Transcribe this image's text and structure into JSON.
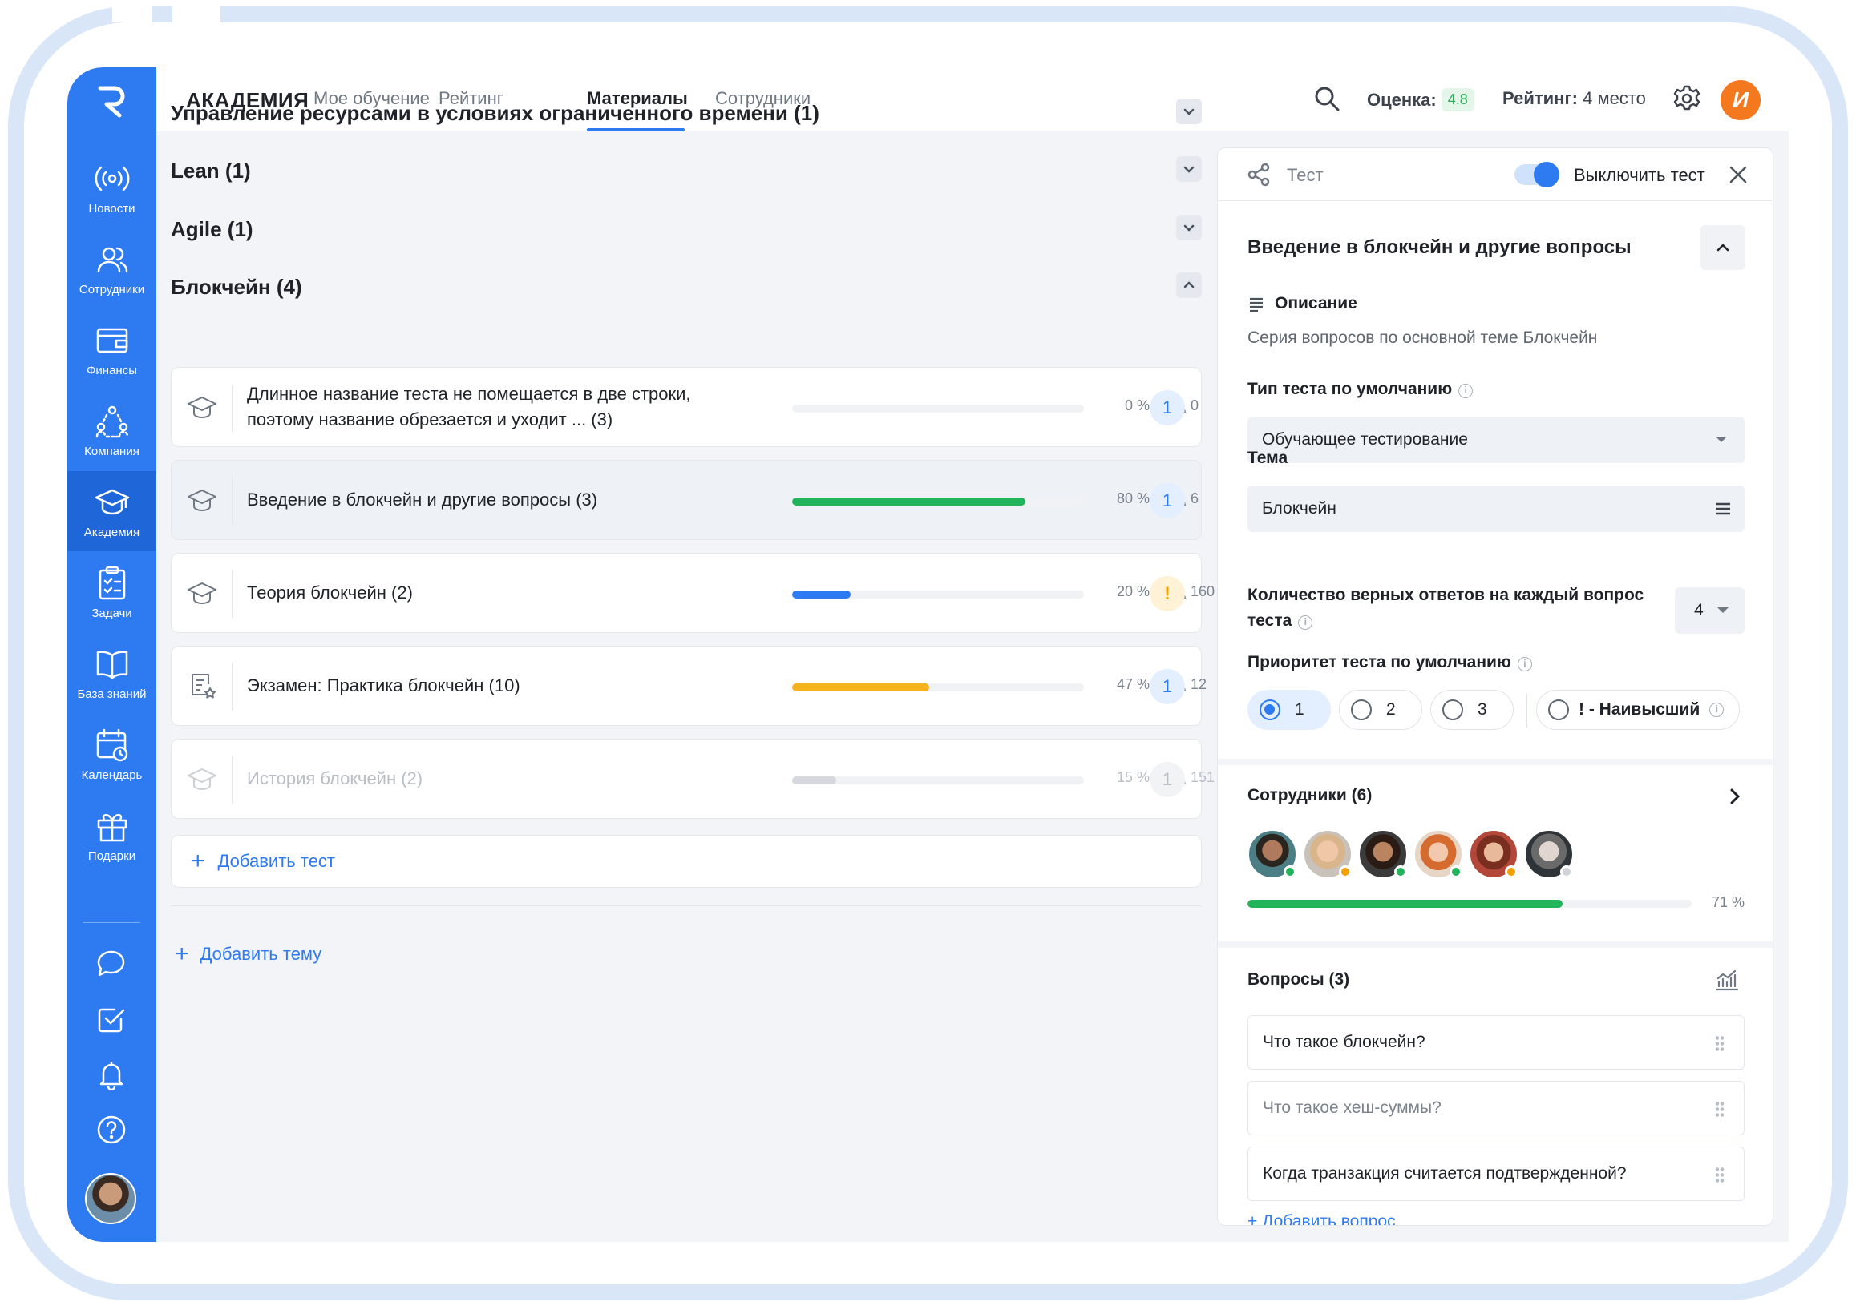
{
  "brand": "АКАДЕМИЯ",
  "tabs": [
    {
      "label": "Мое обучение"
    },
    {
      "label": "Рейтинг"
    },
    {
      "label": "Материалы"
    },
    {
      "label": "Сотрудники"
    }
  ],
  "header": {
    "score_label": "Оценка:",
    "score_value": "4.8",
    "rating_label": "Рейтинг:",
    "rating_value": "4 место",
    "user_initial": "И"
  },
  "sidebar": [
    {
      "label": "Новости",
      "icon": "broadcast-icon"
    },
    {
      "label": "Сотрудники",
      "icon": "users-icon"
    },
    {
      "label": "Финансы",
      "icon": "wallet-icon"
    },
    {
      "label": "Компания",
      "icon": "company-icon"
    },
    {
      "label": "Академия",
      "icon": "graduation-cap-icon"
    },
    {
      "label": "Задачи",
      "icon": "clipboard-icon"
    },
    {
      "label": "База знаний",
      "icon": "book-icon"
    },
    {
      "label": "Календарь",
      "icon": "calendar-icon"
    },
    {
      "label": "Подарки",
      "icon": "gift-icon"
    }
  ],
  "sections": [
    {
      "title": "Управление ресурсами в условиях ограниченного времени (1)"
    },
    {
      "title": "Lean (1)"
    },
    {
      "title": "Agile (1)"
    },
    {
      "title": "Блокчейн (4)"
    }
  ],
  "tests": [
    {
      "name": "Длинное название теста не помещается в две строки, поэтому название обрезается и уходит ... (3)",
      "progress": 0,
      "pct": "0 %",
      "people": "0",
      "badge": "1",
      "color": "#2e7af0"
    },
    {
      "name": "Введение в блокчейн и другие вопросы (3)",
      "progress": 0.8,
      "pct": "80 %",
      "people": "6",
      "badge": "1",
      "color": "#22b45a"
    },
    {
      "name": "Теория блокчейн (2)",
      "progress": 0.2,
      "pct": "20 %",
      "people": "160",
      "badge": "!",
      "color": "#2e7af0"
    },
    {
      "name": "Экзамен: Практика блокчейн (10)",
      "progress": 0.47,
      "pct": "47 %",
      "people": "12",
      "badge": "1",
      "color": "#f5b320"
    },
    {
      "name": "История блокчейн (2)",
      "progress": 0.15,
      "pct": "15 %",
      "people": "151",
      "badge": "1",
      "color": "#d5d9de"
    }
  ],
  "add_test": "Добавить тест",
  "add_theme": "Добавить тему",
  "panel": {
    "type_label": "Тест",
    "toggle_label": "Выключить тест",
    "title": "Введение в блокчейн и другие вопросы",
    "desc_label": "Описание",
    "description": "Серия вопросов по основной теме Блокчейн",
    "test_type_label": "Тип теста по умолчанию",
    "test_type_value": "Обучающее тестирование",
    "theme_label": "Тема",
    "theme_value": "Блокчейн",
    "answers_label_1": "Количество верных ответов на каждый вопрос",
    "answers_label_2": "теста",
    "answers_value": "4",
    "priority_label": "Приоритет теста по умолчанию",
    "priorities": [
      "1",
      "2",
      "3"
    ],
    "priority_highest": "! - Наивысший",
    "priority_selected": "1",
    "employees_label": "Сотрудники (6)",
    "employees_progress": 0.71,
    "employees_pct": "71 %",
    "questions_label": "Вопросы (3)",
    "questions": [
      "Что такое блокчейн?",
      "Что такое хеш-суммы?",
      "Когда транзакция считается подтвержденной?"
    ],
    "add_question": "Добавить вопрос"
  }
}
